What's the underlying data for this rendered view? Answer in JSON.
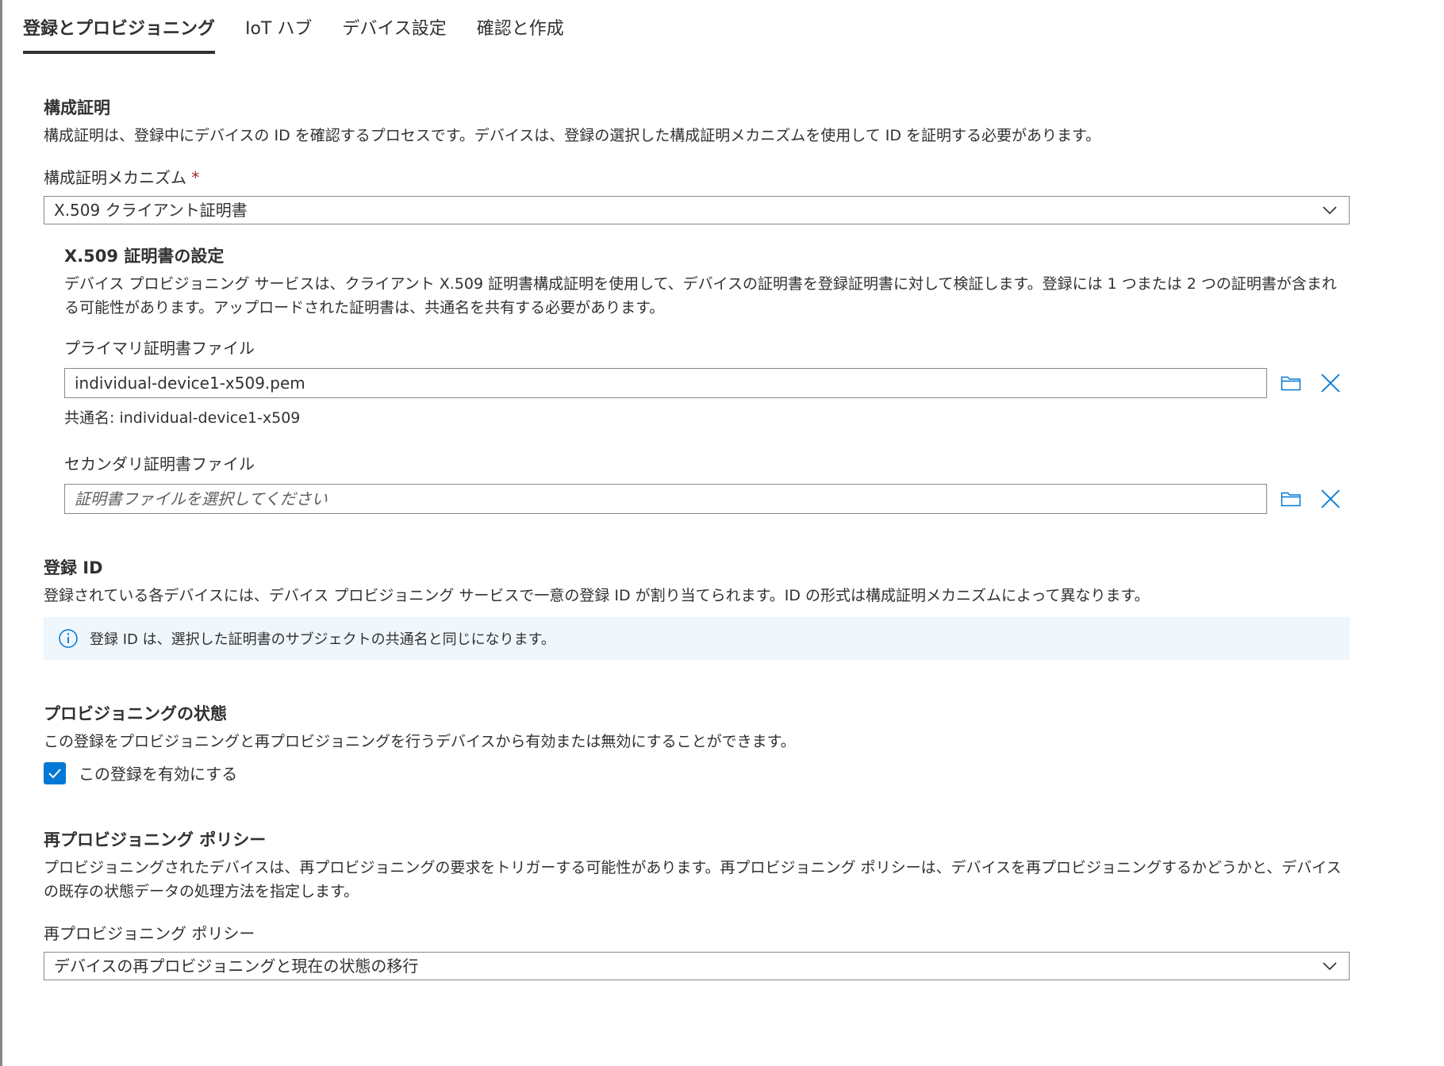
{
  "tabs": [
    {
      "label": "登録とプロビジョニング",
      "active": true
    },
    {
      "label": "IoT ハブ",
      "active": false
    },
    {
      "label": "デバイス設定",
      "active": false
    },
    {
      "label": "確認と作成",
      "active": false
    }
  ],
  "attestation": {
    "heading": "構成証明",
    "description": "構成証明は、登録中にデバイスの ID を確認するプロセスです。デバイスは、登録の選択した構成証明メカニズムを使用して ID を証明する必要があります。",
    "mechanism_label": "構成証明メカニズム",
    "required_mark": "*",
    "mechanism_value": "X.509 クライアント証明書"
  },
  "x509": {
    "heading": "X.509 証明書の設定",
    "description": "デバイス プロビジョニング サービスは、クライアント X.509 証明書構成証明を使用して、デバイスの証明書を登録証明書に対して検証します。登録には 1 つまたは 2 つの証明書が含まれる可能性があります。アップロードされた証明書は、共通名を共有する必要があります。",
    "primary_label": "プライマリ証明書ファイル",
    "primary_value": "individual-device1-x509.pem",
    "primary_common_name": "共通名: individual-device1-x509",
    "secondary_label": "セカンダリ証明書ファイル",
    "secondary_placeholder": "証明書ファイルを選択してください"
  },
  "registration": {
    "heading": "登録 ID",
    "description": "登録されている各デバイスには、デバイス プロビジョニング サービスで一意の登録 ID が割り当てられます。ID の形式は構成証明メカニズムによって異なります。",
    "info": "登録 ID は、選択した証明書のサブジェクトの共通名と同じになります。"
  },
  "provisioning": {
    "heading": "プロビジョニングの状態",
    "description": "この登録をプロビジョニングと再プロビジョニングを行うデバイスから有効または無効にすることができます。",
    "checkbox_label": "この登録を有効にする",
    "checked": true
  },
  "reprovision": {
    "heading": "再プロビジョニング ポリシー",
    "description": "プロビジョニングされたデバイスは、再プロビジョニングの要求をトリガーする可能性があります。再プロビジョニング ポリシーは、デバイスを再プロビジョニングするかどうかと、デバイスの既存の状態データの処理方法を指定します。",
    "policy_label": "再プロビジョニング ポリシー",
    "policy_value": "デバイスの再プロビジョニングと現在の状態の移行"
  },
  "colors": {
    "accent": "#0078d4",
    "info_background": "#eff6fc",
    "text": "#323130",
    "required": "#a4262c"
  }
}
